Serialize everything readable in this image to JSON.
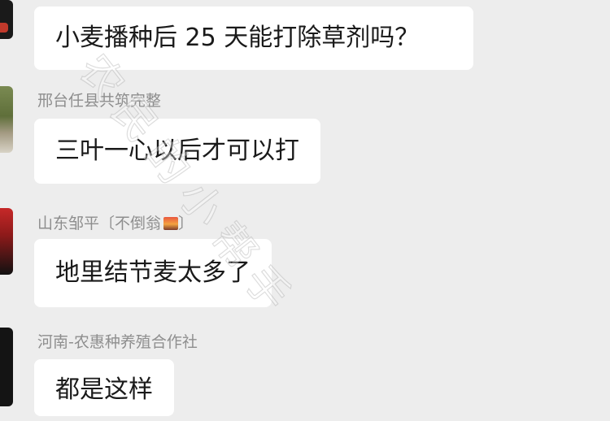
{
  "messages": [
    {
      "sender": "",
      "text": "小麦播种后 25 天能打除草剂吗？"
    },
    {
      "sender": "邢台任县共筑完整",
      "text": "三叶一心以后才可以打"
    },
    {
      "sender_prefix": "山东邹平〔不倒翁",
      "sender_emoji": "sunset-emoji",
      "sender_suffix": "〕",
      "text": "地里结节麦太多了"
    },
    {
      "sender": "河南-农惠种养殖合作社",
      "text": "都是这样"
    }
  ],
  "watermark": "农民的小帮手",
  "colors": {
    "background": "#ededed",
    "bubble": "#ffffff",
    "name": "#8e8e8e",
    "text": "#1a1a1a"
  }
}
